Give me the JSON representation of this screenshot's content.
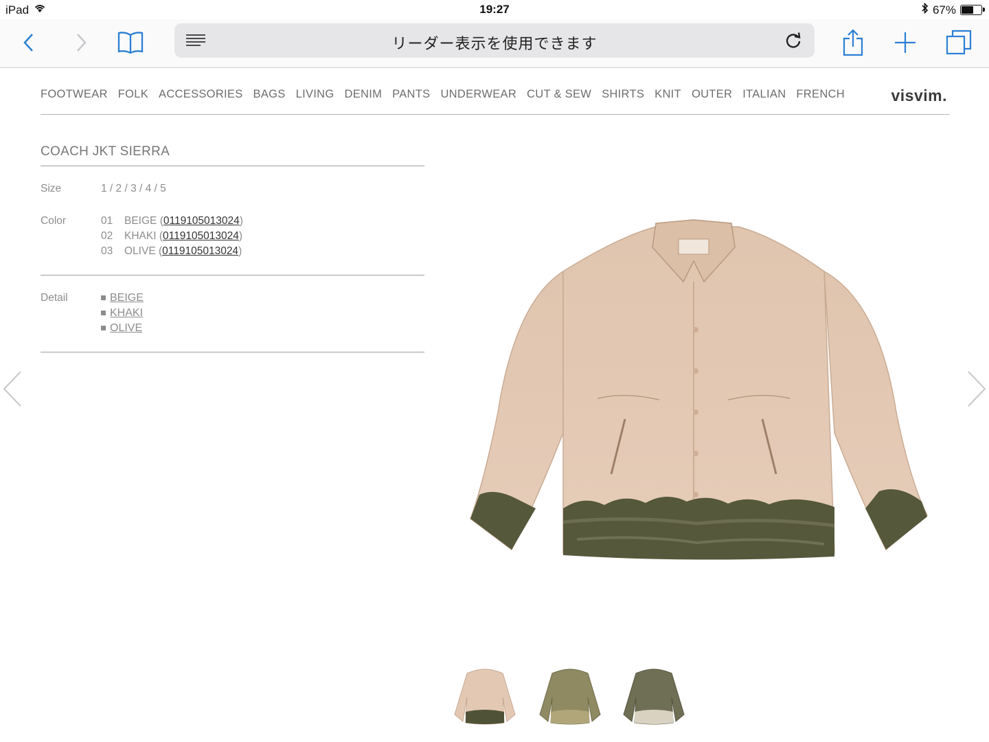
{
  "status_bar": {
    "device": "iPad",
    "time": "19:27",
    "battery": "67%",
    "battery_level": 0.67
  },
  "safari": {
    "address_text": "リーダー表示を使用できます"
  },
  "nav": {
    "items": [
      "FOOTWEAR",
      "FOLK",
      "ACCESSORIES",
      "BAGS",
      "LIVING",
      "DENIM",
      "PANTS",
      "UNDERWEAR",
      "CUT & SEW",
      "SHIRTS",
      "KNIT",
      "OUTER",
      "ITALIAN",
      "FRENCH"
    ],
    "logo": "visvim."
  },
  "product": {
    "title": "COACH JKT SIERRA",
    "size_label": "Size",
    "sizes": "1 / 2 / 3 / 4 / 5",
    "color_label": "Color",
    "colors": [
      {
        "num": "01",
        "name": "BEIGE",
        "code": "0119105013024"
      },
      {
        "num": "02",
        "name": "KHAKI",
        "code": "0119105013024"
      },
      {
        "num": "03",
        "name": "OLIVE",
        "code": "0119105013024"
      }
    ],
    "detail_label": "Detail",
    "details": [
      "BEIGE",
      "KHAKI",
      "OLIVE"
    ]
  },
  "colors": {
    "beige": "#e3c9b4",
    "khaki": "#8f8a62",
    "olive": "#6f6f55",
    "dye": "#4f5237"
  }
}
